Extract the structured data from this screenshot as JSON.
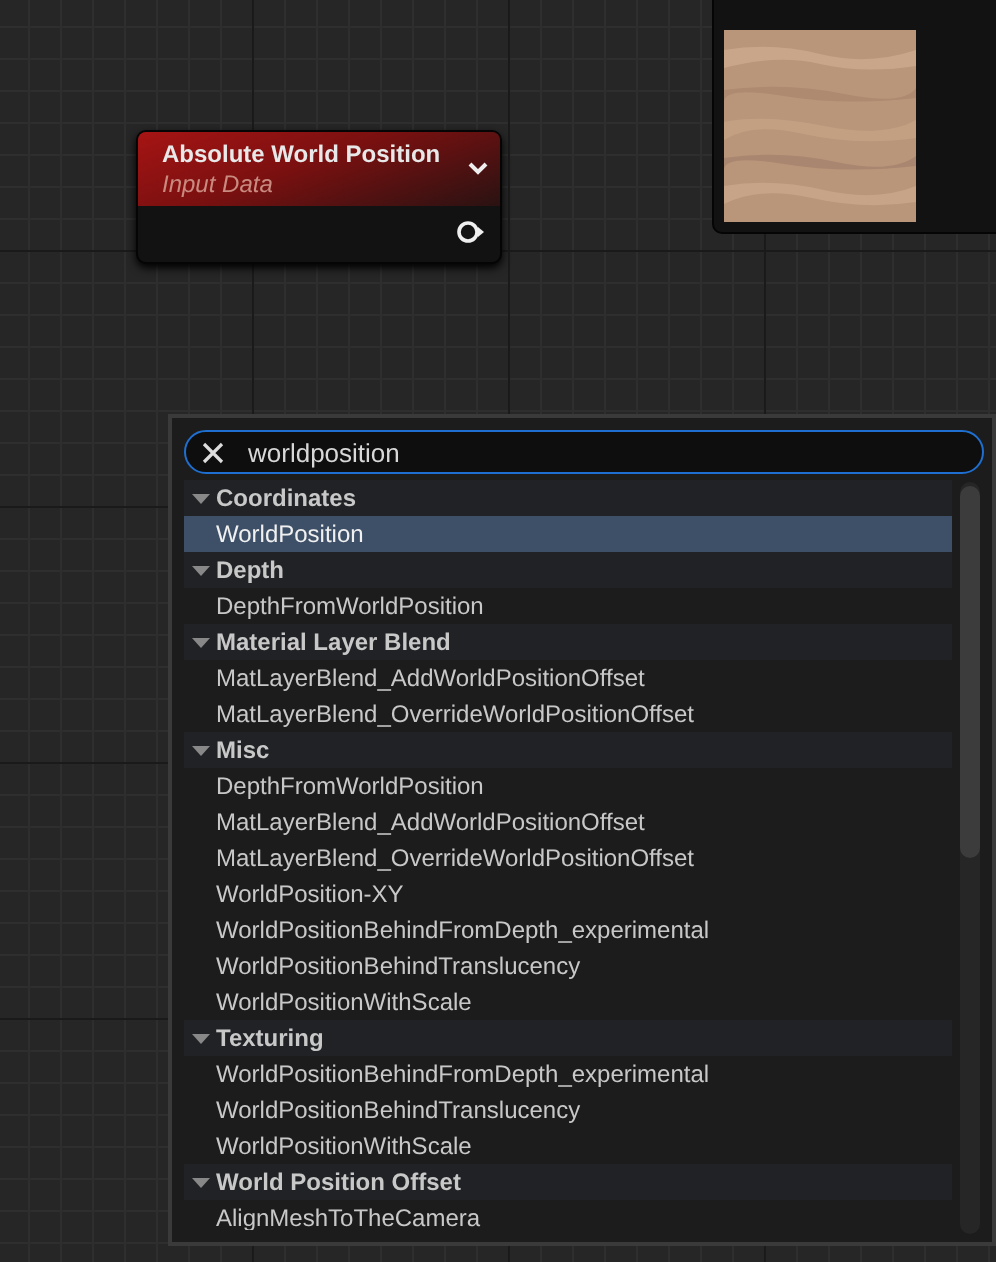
{
  "node": {
    "title": "Absolute World Position",
    "subtitle": "Input Data"
  },
  "search": {
    "value": "worldposition"
  },
  "categories": [
    {
      "label": "Coordinates",
      "expanded": true,
      "children": [
        {
          "label": "WorldPosition",
          "selected": true
        }
      ]
    },
    {
      "label": "Depth",
      "expanded": true,
      "children": [
        {
          "label": "DepthFromWorldPosition",
          "selected": false
        }
      ]
    },
    {
      "label": "Material Layer Blend",
      "expanded": true,
      "children": [
        {
          "label": "MatLayerBlend_AddWorldPositionOffset",
          "selected": false
        },
        {
          "label": "MatLayerBlend_OverrideWorldPositionOffset",
          "selected": false
        }
      ]
    },
    {
      "label": "Misc",
      "expanded": true,
      "children": [
        {
          "label": "DepthFromWorldPosition",
          "selected": false
        },
        {
          "label": "MatLayerBlend_AddWorldPositionOffset",
          "selected": false
        },
        {
          "label": "MatLayerBlend_OverrideWorldPositionOffset",
          "selected": false
        },
        {
          "label": "WorldPosition-XY",
          "selected": false
        },
        {
          "label": "WorldPositionBehindFromDepth_experimental",
          "selected": false
        },
        {
          "label": "WorldPositionBehindTranslucency",
          "selected": false
        },
        {
          "label": "WorldPositionWithScale",
          "selected": false
        }
      ]
    },
    {
      "label": "Texturing",
      "expanded": true,
      "children": [
        {
          "label": "WorldPositionBehindFromDepth_experimental",
          "selected": false
        },
        {
          "label": "WorldPositionBehindTranslucency",
          "selected": false
        },
        {
          "label": "WorldPositionWithScale",
          "selected": false
        }
      ]
    },
    {
      "label": "World Position Offset",
      "expanded": true,
      "children": [
        {
          "label": "AlignMeshToTheCamera",
          "selected": false
        }
      ]
    }
  ]
}
